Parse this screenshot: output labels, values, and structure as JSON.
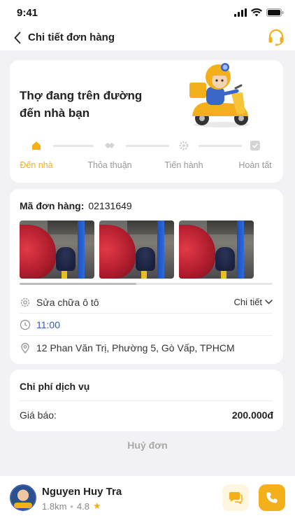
{
  "status_bar": {
    "time": "9:41"
  },
  "header": {
    "title": "Chi tiết đơn hàng"
  },
  "status_card": {
    "message": "Thợ đang trên đường đến nhà bạn",
    "steps": [
      {
        "label": "Đến nhà",
        "active": true,
        "icon": "home-icon"
      },
      {
        "label": "Thỏa thuận",
        "active": false,
        "icon": "handshake-icon"
      },
      {
        "label": "Tiến hành",
        "active": false,
        "icon": "gear-icon"
      },
      {
        "label": "Hoàn tất",
        "active": false,
        "icon": "check-icon"
      }
    ]
  },
  "order": {
    "code_label": "Mã đơn hàng:",
    "code_value": "02131649",
    "photo_scroll_fraction": 0.46,
    "service": "Sửa chữa ô tô",
    "detail_label": "Chi tiết",
    "time": "11:00",
    "address": "12 Phan Văn Trị, Phường 5, Gò Vấp, TPHCM"
  },
  "cost": {
    "title": "Chi phí dịch vụ",
    "quote_label": "Giá báo:",
    "quote_value": "200.000đ"
  },
  "cancel_label": "Huỷ đơn",
  "driver": {
    "name": "Nguyen Huy Tra",
    "distance": "1.8km",
    "rating": "4.8"
  },
  "colors": {
    "accent": "#f4b01b",
    "link": "#2f5fb3"
  }
}
